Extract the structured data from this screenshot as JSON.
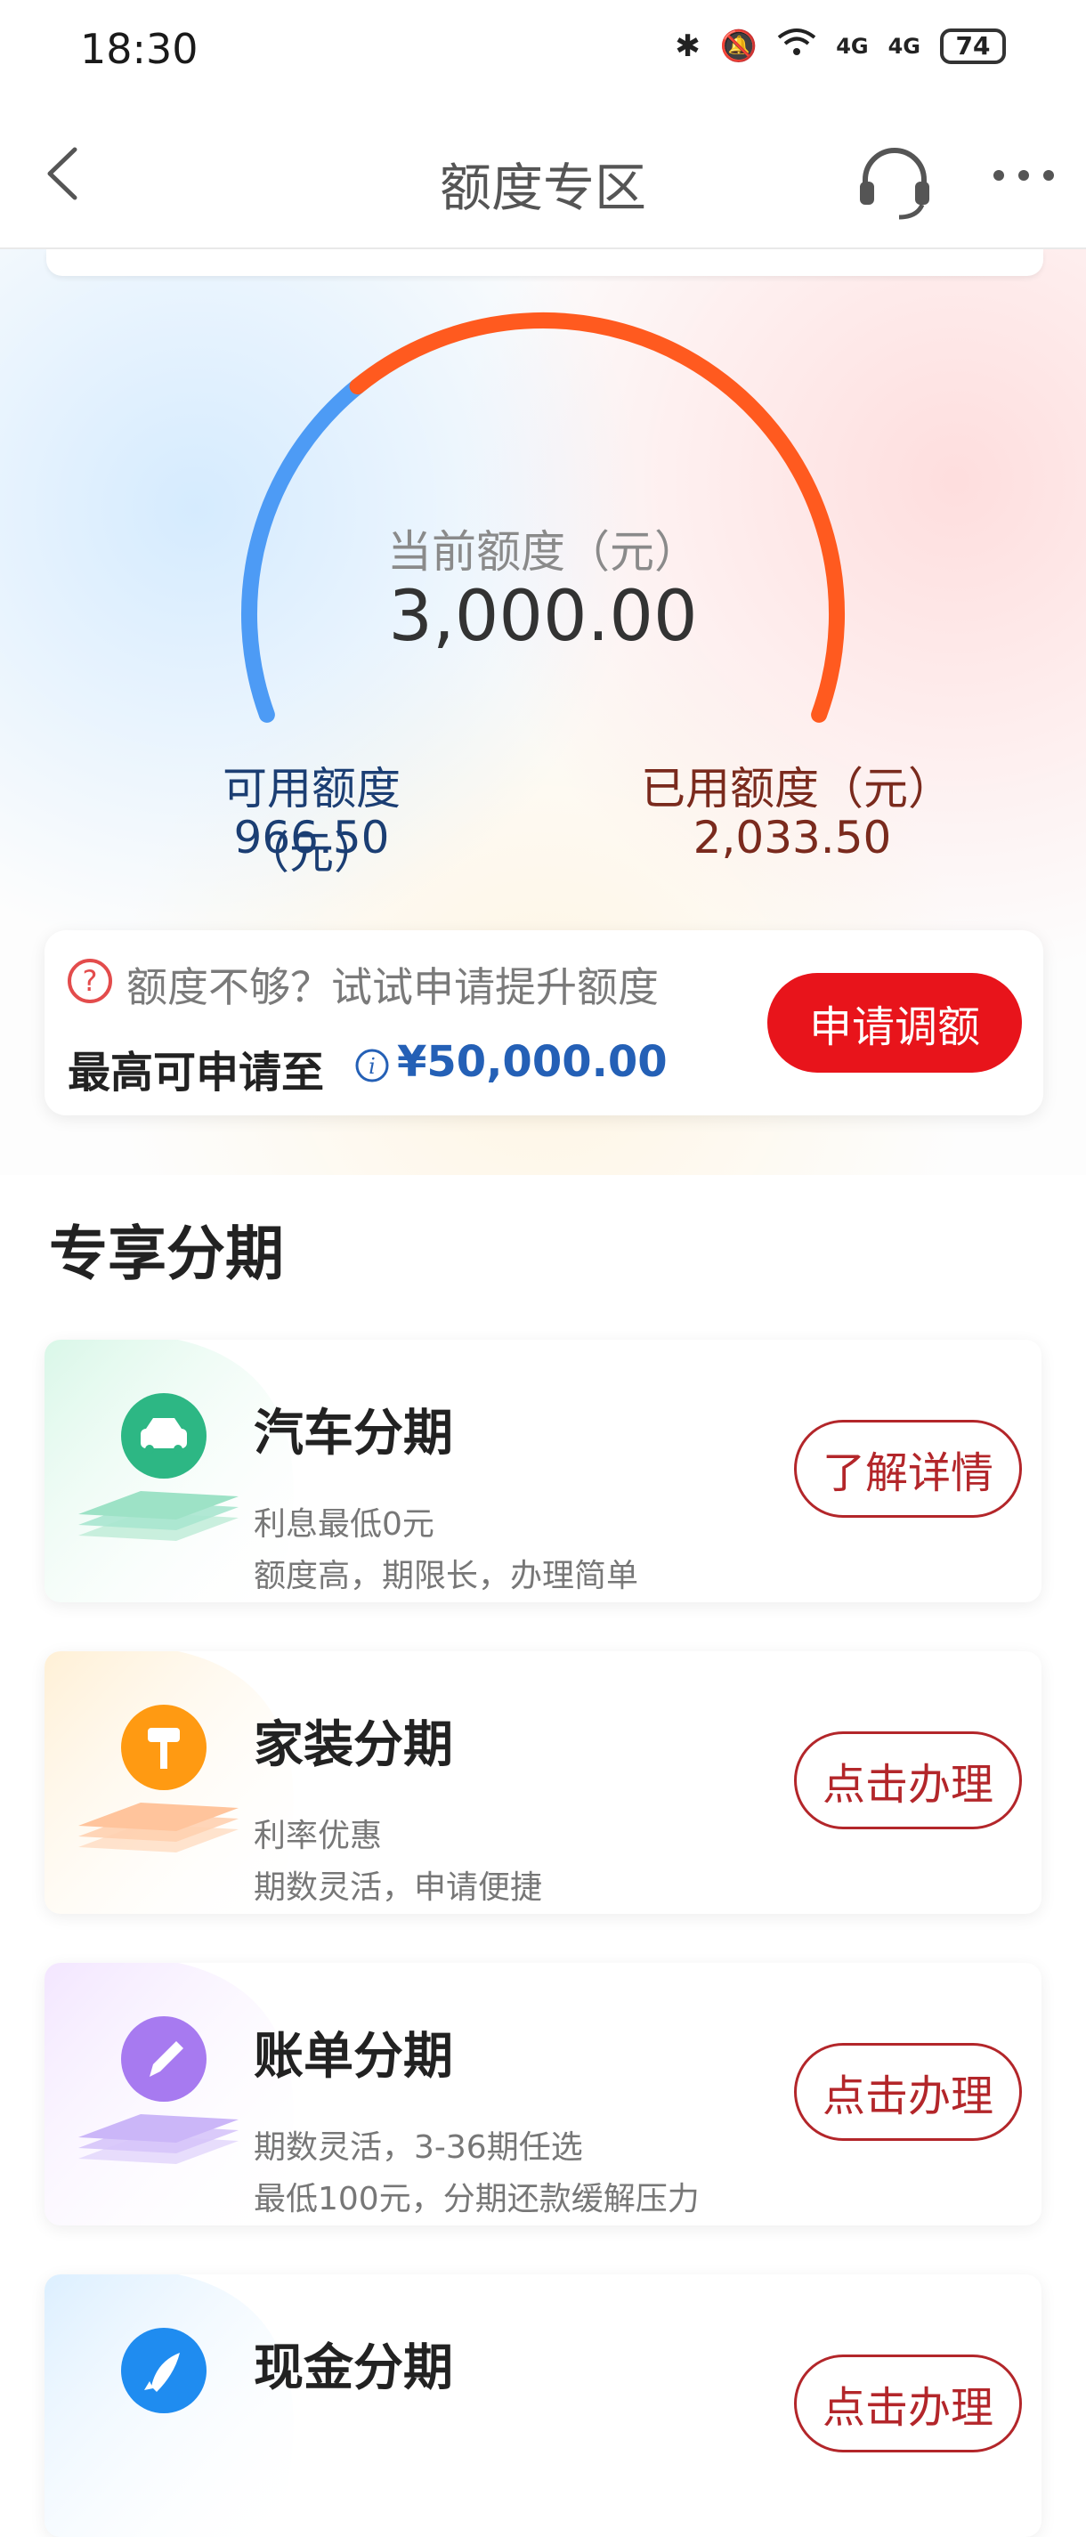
{
  "status_bar": {
    "time": "18:30",
    "battery": "74",
    "net1": "4G",
    "net2": "4G"
  },
  "nav": {
    "title": "额度专区"
  },
  "quota": {
    "current_label": "当前额度（元）",
    "current_value": "3,000.00",
    "available_label": "可用额度（元）",
    "available_value": "966.50",
    "used_label": "已用额度（元）",
    "used_value": "2,033.50",
    "available_fraction": 0.322
  },
  "raise": {
    "hint": "额度不够？试试申请提升额度",
    "max_label": "最高可申请至",
    "max_amount": "¥50,000.00",
    "button": "申请调额"
  },
  "section": {
    "title": "专享分期"
  },
  "loans": [
    {
      "title": "汽车分期",
      "desc1": "利息最低0元",
      "desc2": "额度高，期限长，办理简单",
      "button": "了解详情",
      "icon": "car-icon"
    },
    {
      "title": "家装分期",
      "desc1": "利率优惠",
      "desc2": "期数灵活，申请便捷",
      "button": "点击办理",
      "icon": "paint-roller-icon"
    },
    {
      "title": "账单分期",
      "desc1": "期数灵活，3-36期任选",
      "desc2": "最低100元，分期还款缓解压力",
      "button": "点击办理",
      "icon": "pencil-icon"
    },
    {
      "title": "现金分期",
      "desc1": "",
      "desc2": "",
      "button": "点击办理",
      "icon": "rocket-icon"
    }
  ],
  "colors": {
    "accent_red": "#e8141b",
    "gauge_blue": "#4d9bf5",
    "gauge_orange": "#ff5a1f",
    "link_blue": "#2460b6"
  }
}
